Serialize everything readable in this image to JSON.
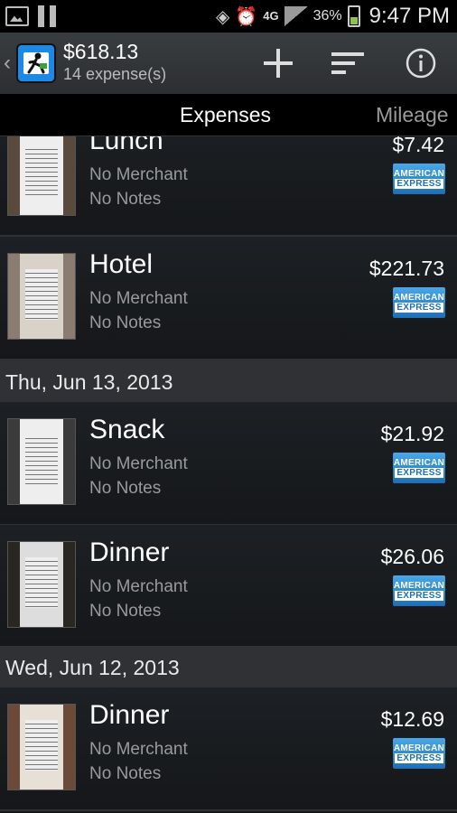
{
  "status_bar": {
    "battery_percent": "36%",
    "network": "4G",
    "time": "9:47 PM"
  },
  "action_bar": {
    "total": "$618.13",
    "count": "14 expense(s)",
    "add_icon": "plus-icon",
    "sort_icon": "sort-icon",
    "info_icon": "info-icon"
  },
  "tabs": [
    {
      "label": "Expenses"
    },
    {
      "label": "Mileage"
    }
  ],
  "sections": [
    {
      "date": "Thu, Jun 13, 2013"
    },
    {
      "date": "Wed, Jun 12, 2013"
    }
  ],
  "expenses": [
    {
      "title": "Lunch",
      "merchant": "No Merchant",
      "notes": "No Notes",
      "amount": "$7.42"
    },
    {
      "title": "Hotel",
      "merchant": "No Merchant",
      "notes": "No Notes",
      "amount": "$221.73"
    },
    {
      "title": "Snack",
      "merchant": "No Merchant",
      "notes": "No Notes",
      "amount": "$21.92"
    },
    {
      "title": "Dinner",
      "merchant": "No Merchant",
      "notes": "No Notes",
      "amount": "$26.06"
    },
    {
      "title": "Dinner",
      "merchant": "No Merchant",
      "notes": "No Notes",
      "amount": "$12.69"
    }
  ],
  "card": {
    "line1": "AMERICAN",
    "line2": "EXPRESS"
  },
  "colors": {
    "card_blue": "#2a86d6",
    "section_bg": "#2f3134",
    "accent": "#1e88e5"
  }
}
